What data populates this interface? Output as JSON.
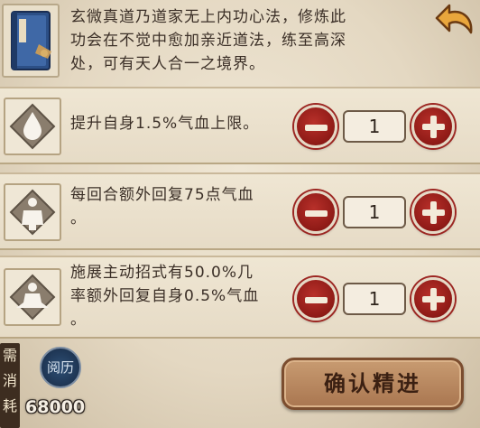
{
  "description": "玄微真道乃道家无上内功心法，修炼此功会在不觉中愈加亲近道法，练至高深处，可有天人合一之境界。",
  "description_lines": [
    "玄微真道乃道家无上内功心法，修炼此",
    "功会在不觉中愈加亲近道法，练至高深",
    "处，可有天人合一之境界。"
  ],
  "skills": [
    {
      "lines": [
        "提升自身1.5%气血上限。"
      ],
      "quantity": "1"
    },
    {
      "lines": [
        "每回合额外回复75点气血",
        "。"
      ],
      "quantity": "1"
    },
    {
      "lines": [
        "施展主动招式有50.0%几",
        "率额外回复自身0.5%气血",
        "。"
      ],
      "quantity": "1"
    }
  ],
  "cost": {
    "need_label": [
      "需",
      "消",
      "耗"
    ],
    "currency_label": "阅历",
    "amount": "68000"
  },
  "confirm_label": "确认精进",
  "colors": {
    "accent_red": "#a12520",
    "parchment": "#e9dfca",
    "button_brown": "#b88460"
  }
}
